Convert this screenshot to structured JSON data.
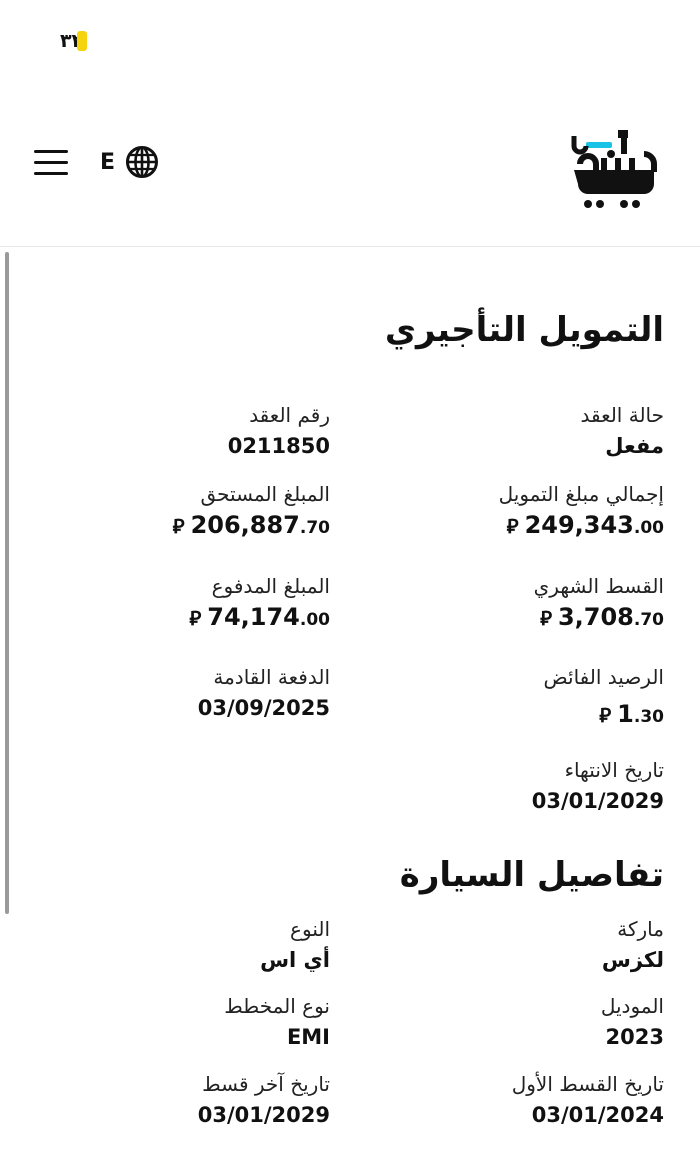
{
  "watermark_top": "٣٢",
  "header": {
    "lang_code": "E"
  },
  "lease": {
    "title": "التمويل التأجيري",
    "contract_status": {
      "label": "حالة العقد",
      "value": "مفعل"
    },
    "contract_number": {
      "label": "رقم العقد",
      "value": "0211850"
    },
    "total_financing": {
      "label": "إجمالي مبلغ التمويل",
      "int": "249,343",
      "dec": ".00"
    },
    "due_amount": {
      "label": "المبلغ المستحق",
      "int": "206,887",
      "dec": ".70"
    },
    "monthly_installment": {
      "label": "القسط الشهري",
      "int": "3,708",
      "dec": ".70"
    },
    "paid_amount": {
      "label": "المبلغ المدفوع",
      "int": "74,174",
      "dec": ".00"
    },
    "surplus_balance": {
      "label": "الرصيد الفائض",
      "int": "1",
      "dec": ".30"
    },
    "next_payment": {
      "label": "الدفعة القادمة",
      "value": "03/09/2025"
    },
    "end_date": {
      "label": "تاريخ الانتهاء",
      "value": "03/01/2029"
    }
  },
  "car": {
    "title": "تفاصيل السيارة",
    "brand": {
      "label": "ماركة",
      "value": "لكزس"
    },
    "type": {
      "label": "النوع",
      "value": "أي اس"
    },
    "model": {
      "label": "الموديل",
      "value": "2023"
    },
    "plan_type": {
      "label": "نوع المخطط",
      "value": "EMI"
    },
    "first_installment": {
      "label": "تاريخ القسط الأول",
      "value": "03/01/2024"
    },
    "last_installment": {
      "label": "تاريخ آخر قسط",
      "value": "03/01/2029"
    }
  },
  "currency_symbol": "⃁",
  "colors": {
    "accent_yellow": "#f5d40f",
    "logo_teal": "#19c3e6",
    "text": "#111111"
  }
}
